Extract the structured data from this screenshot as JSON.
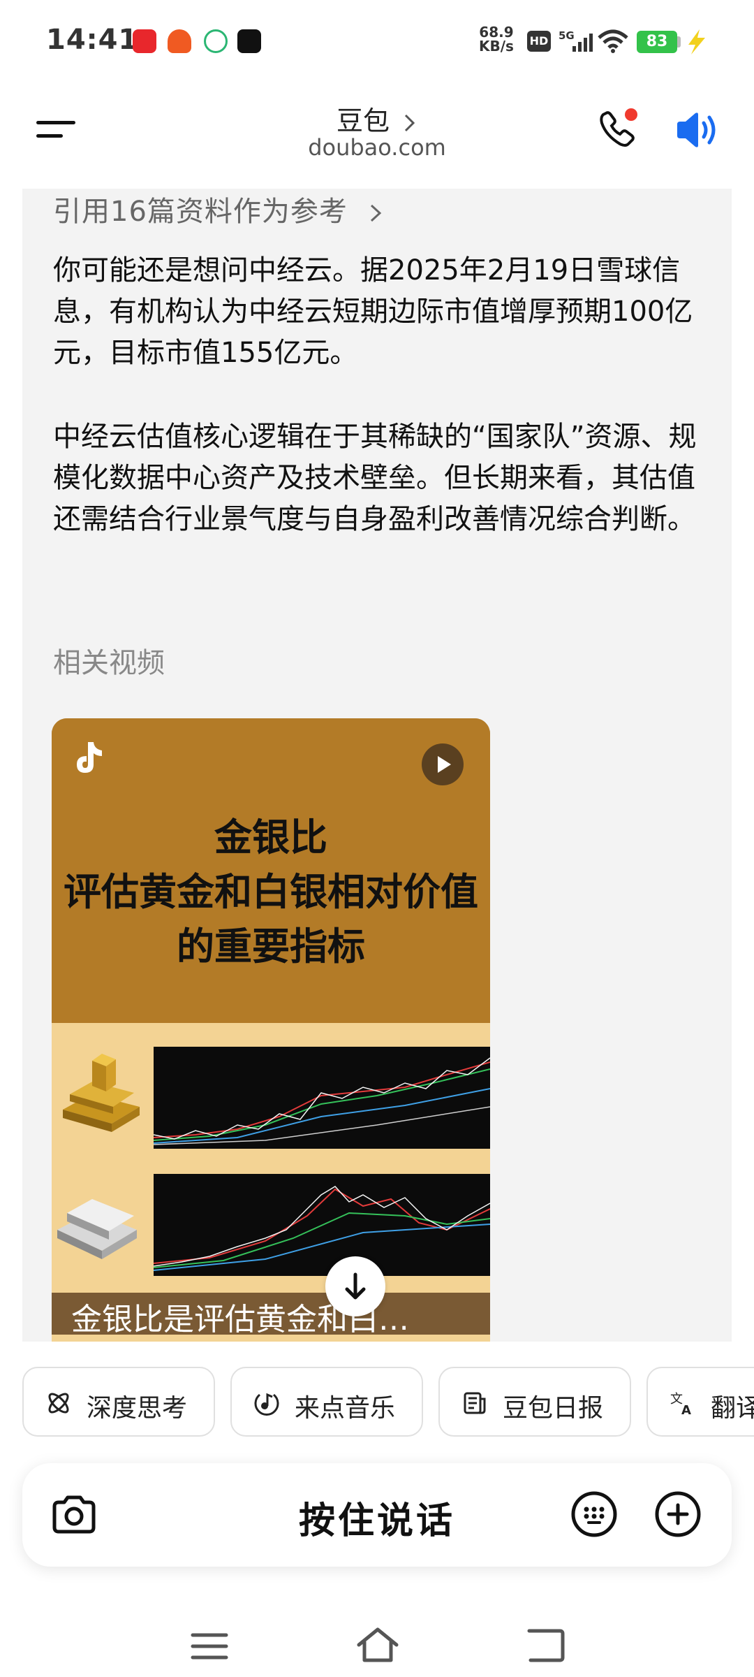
{
  "status_bar": {
    "time": "14:41",
    "net_speed_value": "68.9",
    "net_speed_unit": "KB/s",
    "hd": "HD",
    "network": "5G",
    "battery": "83"
  },
  "header": {
    "title": "豆包",
    "subtitle": "doubao.com"
  },
  "content": {
    "references_link": "引用16篇资料作为参考",
    "paragraphs": [
      "你可能还是想问中经云。据2025年2月19日雪球信息，有机构认为中经云短期边际市值增厚预期100亿元，目标市值155亿元。",
      "中经云估值核心逻辑在于其稀缺的“国家队”资源、规模化数据中心资产及技术壁垒。但长期来看，其估值还需结合行业景气度与自身盈利改善情况综合判断。"
    ],
    "related_videos_label": "相关视频",
    "video": {
      "cover_title_lines": [
        "金银比",
        "评估黄金和白银相对价值",
        "的重要指标"
      ],
      "caption": "金银比是评估黄金和白…"
    }
  },
  "chips": [
    {
      "label": "深度思考",
      "icon": "atom-icon"
    },
    {
      "label": "来点音乐",
      "icon": "music-icon"
    },
    {
      "label": "豆包日报",
      "icon": "newspaper-icon"
    },
    {
      "label": "翻译",
      "icon": "translate-icon"
    }
  ],
  "input_bar": {
    "talk_label": "按住说话"
  },
  "colors": {
    "accent_blue": "#1a6cf0",
    "notify_red": "#f03a2e",
    "video_brown": "#b37b27",
    "battery_green": "#33c24a"
  }
}
